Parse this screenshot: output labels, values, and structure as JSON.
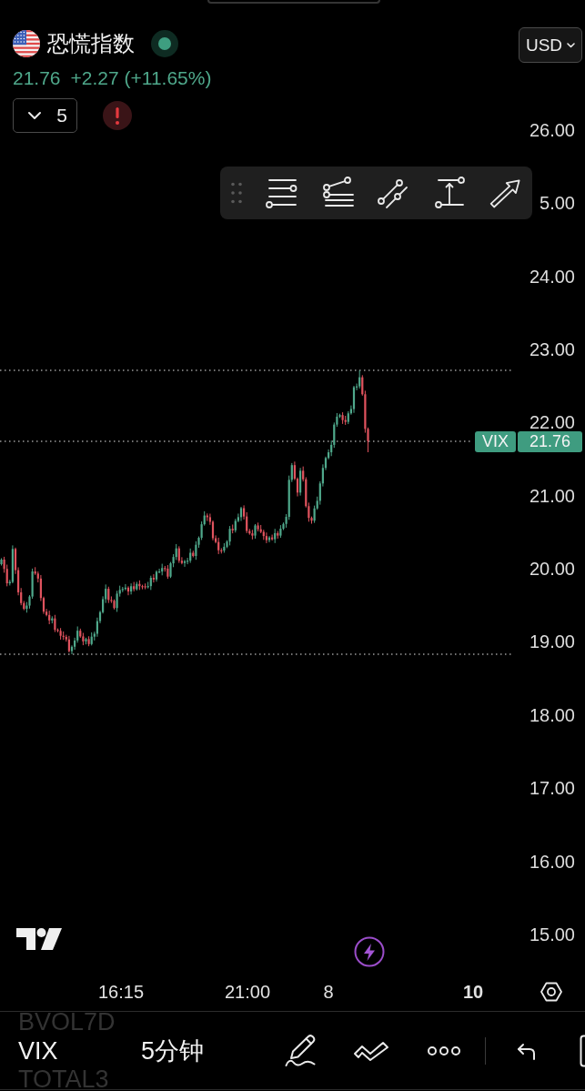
{
  "legend": {
    "title": "恐慌指数",
    "market_open": true,
    "price": "21.76",
    "change": "+2.27 (+11.65%)",
    "indicators_toggle": {
      "count": "5",
      "expanded": false
    },
    "warning": true
  },
  "currency_button": {
    "label": "USD"
  },
  "drawing_toolbar": {
    "tools": [
      {
        "kind": "horizontal_lines"
      },
      {
        "kind": "levels"
      },
      {
        "kind": "parallel_lines"
      },
      {
        "kind": "measure"
      },
      {
        "kind": "arrow"
      }
    ]
  },
  "price_axis": {
    "ticks": [
      "26.00",
      "5.00",
      "24.00",
      "23.00",
      "22.00",
      "21.00",
      "20.00",
      "19.00",
      "18.00",
      "17.00",
      "16.00",
      "15.00"
    ]
  },
  "last_price_label": {
    "symbol": "VIX",
    "price": "21.76"
  },
  "time_axis": {
    "ticks": [
      {
        "label": "16:15",
        "major": false
      },
      {
        "label": "21:00",
        "major": false
      },
      {
        "label": "8",
        "major": false
      },
      {
        "label": "10",
        "major": true
      }
    ]
  },
  "bottom_bar": {
    "symbols": [
      {
        "label": "BVOL7D",
        "selected": false
      },
      {
        "label": "VIX",
        "selected": true
      },
      {
        "label": "TOTAL3",
        "selected": false
      }
    ],
    "interval": "5分钟",
    "tools": [
      {
        "kind": "pencil"
      },
      {
        "kind": "zigzag"
      },
      {
        "kind": "more"
      },
      {
        "kind": "undo"
      },
      {
        "kind": "bracket"
      }
    ]
  }
}
